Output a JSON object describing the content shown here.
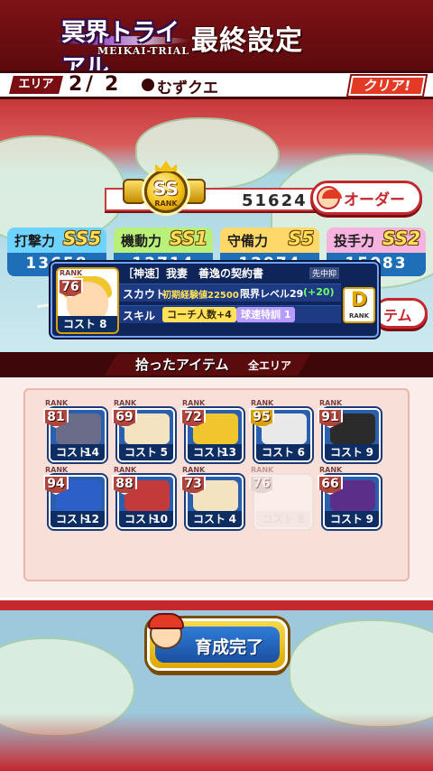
{
  "header": {
    "logo_main": "冥界トライアル",
    "logo_sub": "MEIKAI-TRIAL",
    "title": "最終設定"
  },
  "area": {
    "label": "エリア",
    "current": "2",
    "separator": "/",
    "total": "2",
    "difficulty": "むずクエ",
    "clear_badge": "クリア!"
  },
  "team": {
    "rank_grade": "SS",
    "rank_label": "RANK",
    "score": "51624",
    "order_button": "オーダー"
  },
  "stats": [
    {
      "name": "打撃力",
      "grade": "SS5",
      "value": "13658",
      "color": "#6fd3ff"
    },
    {
      "name": "機動力",
      "grade": "SS1",
      "value": "12714",
      "color": "#b8f07a"
    },
    {
      "name": "守備力",
      "grade": "S5",
      "value": "12974",
      "color": "#ffd86a"
    },
    {
      "name": "投手力",
      "grade": "SS2",
      "value": "15083",
      "color": "#f7b3e0"
    }
  ],
  "item_button_peek": "テム",
  "tooltip": {
    "rank": "76",
    "rank_label": "RANK",
    "cost": "コスト 8",
    "title": "［神速］我妻　善逸の契約書",
    "position": "先中抑",
    "scout_label": "スカウト",
    "scout_value": "初期経験値22500",
    "limit": "限界レベル29",
    "limit_plus": "(+20)",
    "skill_label": "スキル",
    "skills": [
      "コーチ人数+4",
      "球速特訓 1"
    ],
    "item_rank": "D",
    "item_rank_label": "RANK"
  },
  "section": {
    "title": "拾ったアイテム",
    "scope": "全エリア"
  },
  "items": [
    {
      "rank": "81",
      "cost": "14",
      "badge": "#b0453d",
      "art": "#6b6b8a"
    },
    {
      "rank": "69",
      "cost": "5",
      "badge": "#b0453d",
      "art": "#f4e3c0"
    },
    {
      "rank": "72",
      "cost": "13",
      "badge": "#b0453d",
      "art": "#f0c52d"
    },
    {
      "rank": "95",
      "cost": "6",
      "badge": "#d7a200",
      "art": "#e9e9e9"
    },
    {
      "rank": "91",
      "cost": "9",
      "badge": "#b0453d",
      "art": "#2b2b2b"
    },
    {
      "rank": "94",
      "cost": "12",
      "badge": "#b0453d",
      "art": "#2d5fc8"
    },
    {
      "rank": "88",
      "cost": "10",
      "badge": "#b0453d",
      "art": "#c23a3a"
    },
    {
      "rank": "73",
      "cost": "4",
      "badge": "#b0453d",
      "art": "#f4e3c0"
    },
    {
      "rank": "76",
      "cost": "8",
      "badge": "#cccccc",
      "art": "#ffffff"
    },
    {
      "rank": "66",
      "cost": "9",
      "badge": "#b0453d",
      "art": "#5b2e8a"
    }
  ],
  "cost_label": "コスト",
  "rank_label": "RANK",
  "complete_button": "育成完了"
}
